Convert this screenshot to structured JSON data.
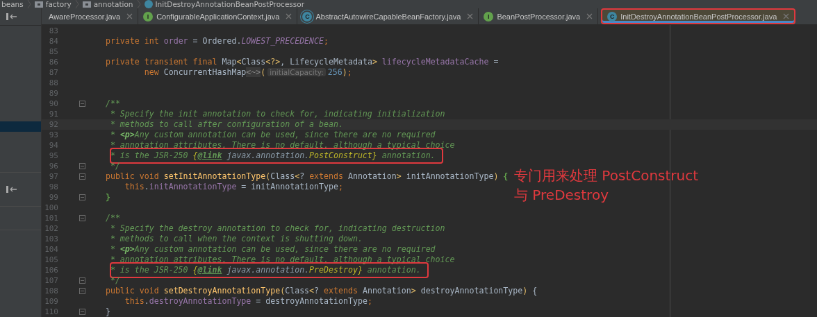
{
  "breadcrumb": [
    {
      "label": "beans",
      "kind": "text"
    },
    {
      "label": "factory",
      "kind": "package"
    },
    {
      "label": "annotation",
      "kind": "package"
    },
    {
      "label": "InitDestroyAnnotationBeanPostProcessor",
      "kind": "class"
    }
  ],
  "tabs": [
    {
      "label": "AwareProcessor.java",
      "kind": "none",
      "selected": false
    },
    {
      "label": "ConfigurableApplicationContext.java",
      "kind": "interface",
      "icon_letter": "I",
      "selected": false
    },
    {
      "label": "AbstractAutowireCapableBeanFactory.java",
      "kind": "abstract",
      "icon_letter": "C",
      "selected": false
    },
    {
      "label": "BeanPostProcessor.java",
      "kind": "interface",
      "icon_letter": "I",
      "selected": false
    },
    {
      "label": "InitDestroyAnnotationBeanPostProcessor.java",
      "kind": "class",
      "icon_letter": "C",
      "selected": true
    }
  ],
  "lines": [
    {
      "number": "83",
      "fold_marker": false,
      "current": false,
      "boxed": false
    },
    {
      "number": "84",
      "fold_marker": false,
      "current": false,
      "boxed": false,
      "tokens": [
        {
          "kind": "kw",
          "text": "    private int "
        },
        {
          "kind": "field",
          "text": "order"
        },
        {
          "kind": "plain",
          "text": " = Ordered."
        },
        {
          "kind": "const",
          "text": "LOWEST_PRECEDENCE"
        },
        {
          "kind": "kw",
          "text": ";"
        }
      ]
    },
    {
      "number": "85",
      "fold_marker": false,
      "current": false,
      "boxed": false
    },
    {
      "number": "86",
      "fold_marker": false,
      "current": false,
      "boxed": false,
      "tokens": [
        {
          "kind": "kw",
          "text": "    private transient final "
        },
        {
          "kind": "plain",
          "text": "Map"
        },
        {
          "kind": "br",
          "text": "<"
        },
        {
          "kind": "plain",
          "text": "Class"
        },
        {
          "kind": "br",
          "text": "<?>"
        },
        {
          "kind": "plain",
          "text": ", LifecycleMetadata"
        },
        {
          "kind": "br",
          "text": ">"
        },
        {
          "kind": "field",
          "text": " lifecycleMetadataCache"
        },
        {
          "kind": "plain",
          "text": " ="
        }
      ]
    },
    {
      "number": "87",
      "fold_marker": false,
      "current": false,
      "boxed": false,
      "tokens": [
        {
          "kind": "kw",
          "text": "            new "
        },
        {
          "kind": "plain",
          "text": "ConcurrentHashMap"
        },
        {
          "kind": "fold",
          "text": "<~>"
        },
        {
          "kind": "br",
          "text": "("
        },
        {
          "kind": "hint",
          "text": "initialCapacity:"
        },
        {
          "kind": "num",
          "text": "256"
        },
        {
          "kind": "br",
          "text": ")"
        },
        {
          "kind": "kw",
          "text": ";"
        }
      ]
    },
    {
      "number": "88",
      "fold_marker": false,
      "current": false,
      "boxed": false
    },
    {
      "number": "89",
      "fold_marker": false,
      "current": false,
      "boxed": false
    },
    {
      "number": "90",
      "fold_marker": true,
      "current": false,
      "boxed": false,
      "tokens": [
        {
          "kind": "comment",
          "text": "    /**"
        }
      ]
    },
    {
      "number": "91",
      "fold_marker": false,
      "current": false,
      "boxed": false,
      "tokens": [
        {
          "kind": "comment",
          "text": "     * Specify the init annotation to check for, indicating initialization"
        }
      ]
    },
    {
      "number": "92",
      "fold_marker": false,
      "current": true,
      "boxed": false,
      "tokens": [
        {
          "kind": "comment",
          "text": "     * methods to call after configuration of a bean."
        }
      ]
    },
    {
      "number": "93",
      "fold_marker": false,
      "current": false,
      "boxed": false,
      "tokens": [
        {
          "kind": "comment",
          "text": "     * "
        },
        {
          "kind": "tag",
          "text": "<p>"
        },
        {
          "kind": "comment",
          "text": "Any custom annotation can be used, since there are no required"
        }
      ]
    },
    {
      "number": "94",
      "fold_marker": false,
      "current": false,
      "boxed": false,
      "tokens": [
        {
          "kind": "comment",
          "text": "     * annotation attributes. There is no default, although a typical choice"
        }
      ]
    },
    {
      "number": "95",
      "fold_marker": false,
      "current": false,
      "boxed": true,
      "tokens": [
        {
          "kind": "comment",
          "text": "     * is the JSR-250 "
        },
        {
          "kind": "docbrace",
          "text": "{"
        },
        {
          "kind": "link",
          "text": "@link"
        },
        {
          "kind": "docref",
          "text": " javax.annotation."
        },
        {
          "kind": "docbrace",
          "text": "PostConstruct}"
        },
        {
          "kind": "comment",
          "text": " annotation."
        }
      ]
    },
    {
      "number": "96",
      "fold_marker": true,
      "current": false,
      "boxed": false,
      "tokens": [
        {
          "kind": "comment",
          "text": "     */"
        }
      ]
    },
    {
      "number": "97",
      "fold_marker": true,
      "current": false,
      "boxed": false,
      "tokens": [
        {
          "kind": "kw",
          "text": "    public void "
        },
        {
          "kind": "method",
          "text": "setInitAnnotationType"
        },
        {
          "kind": "br",
          "text": "("
        },
        {
          "kind": "plain",
          "text": "Class"
        },
        {
          "kind": "br",
          "text": "<"
        },
        {
          "kind": "plain",
          "text": "? "
        },
        {
          "kind": "kw",
          "text": "extends"
        },
        {
          "kind": "plain",
          "text": " Annotation"
        },
        {
          "kind": "br",
          "text": ">"
        },
        {
          "kind": "plain",
          "text": " initAnnotationType"
        },
        {
          "kind": "br",
          "text": ")"
        },
        {
          "kind": "match",
          "text": " {"
        }
      ]
    },
    {
      "number": "98",
      "fold_marker": false,
      "current": false,
      "boxed": false,
      "tokens": [
        {
          "kind": "kw",
          "text": "        this"
        },
        {
          "kind": "plain",
          "text": "."
        },
        {
          "kind": "field",
          "text": "initAnnotationType"
        },
        {
          "kind": "plain",
          "text": " = initAnnotationType"
        },
        {
          "kind": "kw",
          "text": ";"
        }
      ]
    },
    {
      "number": "99",
      "fold_marker": true,
      "current": false,
      "boxed": false,
      "tokens": [
        {
          "kind": "match",
          "text": "    }"
        }
      ]
    },
    {
      "number": "100",
      "fold_marker": false,
      "current": false,
      "boxed": false
    },
    {
      "number": "101",
      "fold_marker": true,
      "current": false,
      "boxed": false,
      "tokens": [
        {
          "kind": "comment",
          "text": "    /**"
        }
      ]
    },
    {
      "number": "102",
      "fold_marker": false,
      "current": false,
      "boxed": false,
      "tokens": [
        {
          "kind": "comment",
          "text": "     * Specify the destroy annotation to check for, indicating destruction"
        }
      ]
    },
    {
      "number": "103",
      "fold_marker": false,
      "current": false,
      "boxed": false,
      "tokens": [
        {
          "kind": "comment",
          "text": "     * methods to call when the context is shutting down."
        }
      ]
    },
    {
      "number": "104",
      "fold_marker": false,
      "current": false,
      "boxed": false,
      "tokens": [
        {
          "kind": "comment",
          "text": "     * "
        },
        {
          "kind": "tag",
          "text": "<p>"
        },
        {
          "kind": "comment",
          "text": "Any custom annotation can be used, since there are no required"
        }
      ]
    },
    {
      "number": "105",
      "fold_marker": false,
      "current": false,
      "boxed": false,
      "tokens": [
        {
          "kind": "comment",
          "text": "     * annotation attributes. There is no default, although a typical choice"
        }
      ]
    },
    {
      "number": "106",
      "fold_marker": false,
      "current": false,
      "boxed": true,
      "tokens": [
        {
          "kind": "comment",
          "text": "     * is the JSR-250 "
        },
        {
          "kind": "docbrace",
          "text": "{"
        },
        {
          "kind": "link",
          "text": "@link"
        },
        {
          "kind": "docref",
          "text": " javax.annotation."
        },
        {
          "kind": "docbrace",
          "text": "PreDestroy}"
        },
        {
          "kind": "comment",
          "text": " annotation."
        }
      ]
    },
    {
      "number": "107",
      "fold_marker": true,
      "current": false,
      "boxed": false,
      "tokens": [
        {
          "kind": "comment",
          "text": "     */"
        }
      ]
    },
    {
      "number": "108",
      "fold_marker": true,
      "current": false,
      "boxed": false,
      "tokens": [
        {
          "kind": "kw",
          "text": "    public void "
        },
        {
          "kind": "method",
          "text": "setDestroyAnnotationType"
        },
        {
          "kind": "br",
          "text": "("
        },
        {
          "kind": "plain",
          "text": "Class"
        },
        {
          "kind": "br",
          "text": "<"
        },
        {
          "kind": "plain",
          "text": "? "
        },
        {
          "kind": "kw",
          "text": "extends"
        },
        {
          "kind": "plain",
          "text": " Annotation"
        },
        {
          "kind": "br",
          "text": ">"
        },
        {
          "kind": "plain",
          "text": " destroyAnnotationType"
        },
        {
          "kind": "br",
          "text": ")"
        },
        {
          "kind": "plain",
          "text": " {"
        }
      ]
    },
    {
      "number": "109",
      "fold_marker": false,
      "current": false,
      "boxed": false,
      "tokens": [
        {
          "kind": "kw",
          "text": "        this"
        },
        {
          "kind": "plain",
          "text": "."
        },
        {
          "kind": "field",
          "text": "destroyAnnotationType"
        },
        {
          "kind": "plain",
          "text": " = destroyAnnotationType"
        },
        {
          "kind": "kw",
          "text": ";"
        }
      ]
    },
    {
      "number": "110",
      "fold_marker": true,
      "current": false,
      "boxed": false,
      "tokens": [
        {
          "kind": "plain",
          "text": "    }"
        }
      ]
    }
  ],
  "annotation_note": [
    "专门用来处理 PostConstruct",
    "与 PreDestroy"
  ]
}
